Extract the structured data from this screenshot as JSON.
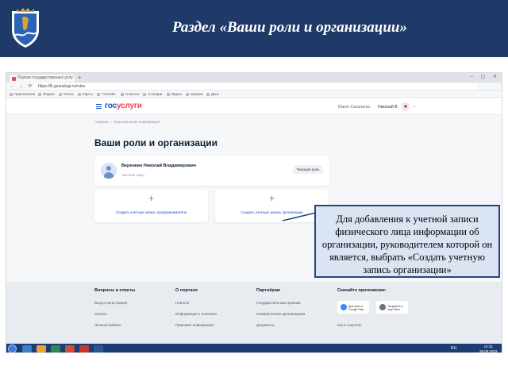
{
  "slide": {
    "title": "Раздел «Ваши роли и организации»"
  },
  "browser": {
    "tab_title": "Портал государственных услу",
    "new_tab": "+",
    "window_controls": "– ▢ ✕",
    "nav_buttons": "← → ⟳",
    "url": "https://lk.gosuslugi.ru/roles",
    "bookmarks": [
      "Приложения",
      "Яндекс",
      "Почта",
      "Карты",
      "YouTube",
      "Новости",
      "Словари",
      "Видео",
      "Музыка",
      "Диск"
    ]
  },
  "gosuslugi_header": {
    "logo_part1": "гос",
    "logo_part2": "услуги",
    "region": "Южно-Сахалинск",
    "user": "Николай В.",
    "chevron": "⌄"
  },
  "breadcrumb": "Главная  →  Персональная информация",
  "page_title": "Ваши роли и организации",
  "person": {
    "name": "Веренкин Николай Владимирович",
    "role": "Частное лицо",
    "button": "Текущая роль"
  },
  "create_cards": [
    {
      "plus": "+",
      "label": "Создать учетную запись предпринимателя"
    },
    {
      "plus": "+",
      "label": "Создать учетную запись организации"
    }
  ],
  "footer": {
    "columns": [
      {
        "title": "Вопросы и ответы",
        "items": [
          "Вход и регистрация",
          "Оплата",
          "Личный кабинет"
        ]
      },
      {
        "title": "О портале",
        "items": [
          "Новости",
          "Информация о платежах",
          "Правовая информация"
        ]
      },
      {
        "title": "Партнёрам",
        "items": [
          "Государственным органам",
          "Коммерческим организациям",
          "Документы"
        ]
      },
      {
        "title": "Скачайте приложение:",
        "items": [
          "Мы в соцсетях"
        ]
      }
    ],
    "stores": [
      {
        "label": "Доступно в Google Play",
        "color": "#4285f4"
      },
      {
        "label": "Загрузите в App Store",
        "color": "#6b7280"
      }
    ]
  },
  "taskbar": {
    "lang": "RU",
    "time": "10:31",
    "date": "28.09.2022"
  },
  "callout": {
    "text": "Для добавления к учетной записи физического лица информации об организации, руководителем которой он является, выбрать «Создать учетную запись организации»"
  },
  "colors": {
    "header_bg": "#1f3a68",
    "gosuslugi_blue": "#0d4cd3",
    "gosuslugi_red": "#ee3f58",
    "callout_bg": "#dbe4f3",
    "callout_border": "#27467a"
  }
}
